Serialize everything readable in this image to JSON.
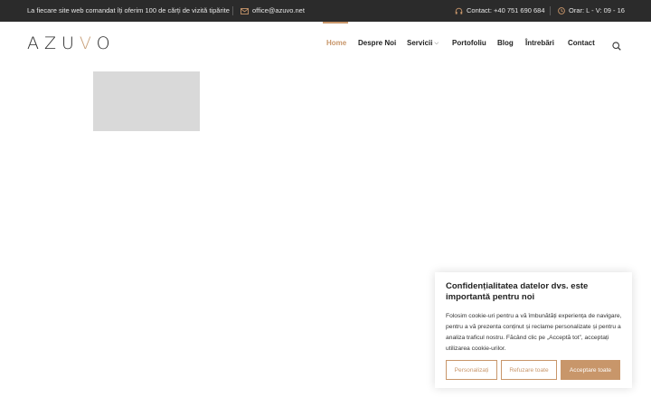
{
  "topbar": {
    "promo": "La fiecare site web comandat îți oferim 100 de cărți de vizită tipărite",
    "email": "office@azuvo.net",
    "phone": "Contact: +40 751 690 684",
    "hours": "Orar: L - V: 09 - 16"
  },
  "header": {
    "logo_prefix": "AZU",
    "logo_accent": "V",
    "logo_suffix": "O",
    "nav": [
      {
        "label": "Home",
        "active": true
      },
      {
        "label": "Despre Noi"
      },
      {
        "label": "Servicii",
        "has_dropdown": true
      },
      {
        "label": "Portofoliu"
      },
      {
        "label": "Blog"
      },
      {
        "label": "Întrebări"
      },
      {
        "label": "Contact"
      }
    ]
  },
  "cookie": {
    "title": "Confidențialitatea datelor dvs. este importantă pentru noi",
    "text": "Folosim cookie-uri pentru a vă îmbunătăți experiența de navigare, pentru a vă prezenta conținut și reclame personalizate și pentru a analiza traficul nostru. Făcând clic pe „Acceptă tot”, acceptați utilizarea cookie-urilor.",
    "buttons": {
      "customize": "Personalizați",
      "reject": "Refuzare toate",
      "accept": "Acceptare toate"
    }
  },
  "colors": {
    "accent": "#c8966a",
    "topbar_bg": "#2b2b2b",
    "placeholder": "#d9d9d9"
  }
}
